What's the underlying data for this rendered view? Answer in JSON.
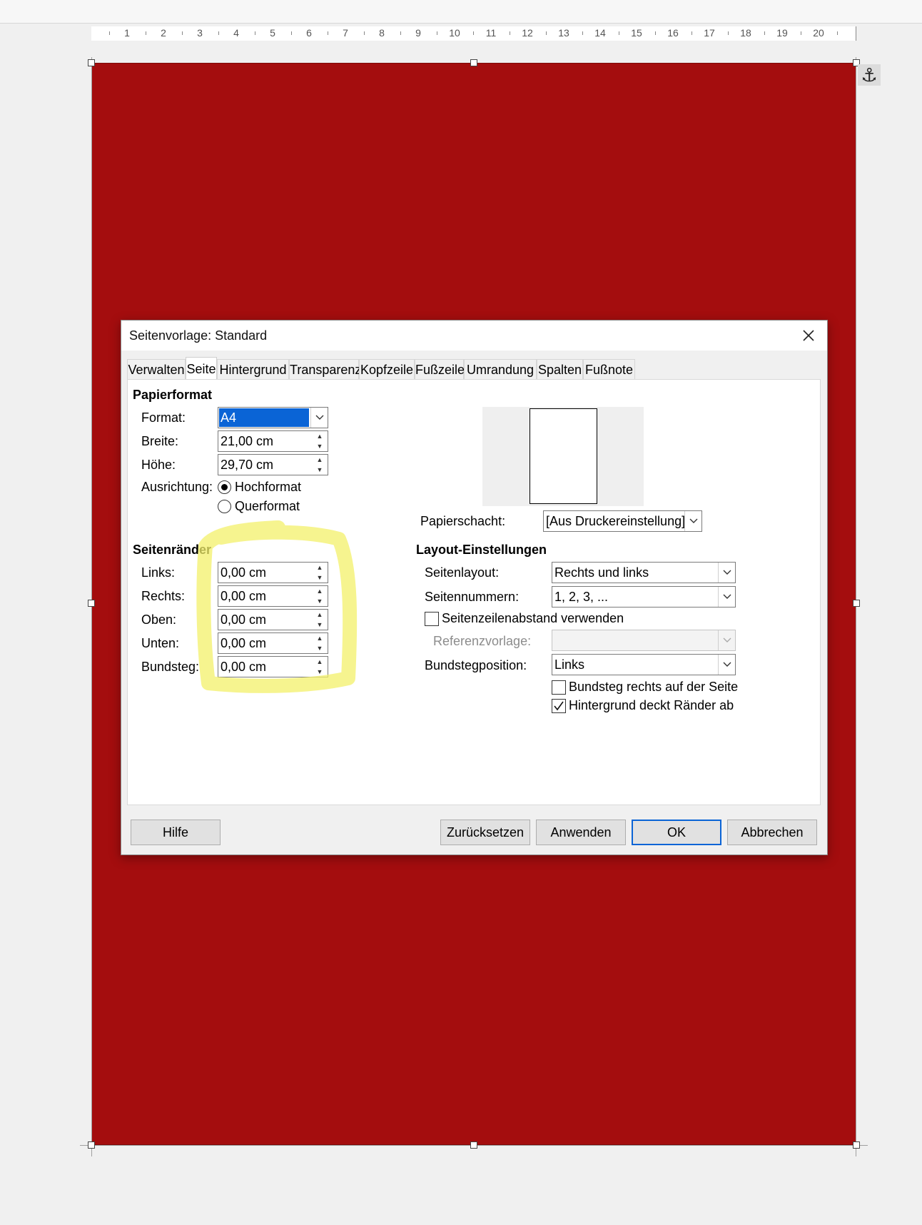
{
  "ruler": {
    "numbers": [
      "1",
      "2",
      "3",
      "4",
      "5",
      "6",
      "7",
      "8",
      "9",
      "10",
      "11",
      "12",
      "13",
      "14",
      "15",
      "16",
      "17",
      "18",
      "19",
      "20"
    ]
  },
  "page": {
    "background_color": "#a40d0e"
  },
  "dialog": {
    "title": "Seitenvorlage: Standard",
    "tabs": [
      "Verwalten",
      "Seite",
      "Hintergrund",
      "Transparenz",
      "Kopfzeile",
      "Fußzeile",
      "Umrandung",
      "Spalten",
      "Fußnote"
    ],
    "active_tab": "Seite",
    "papierformat": {
      "heading": "Papierformat",
      "format_label": "Format:",
      "format_value": "A4",
      "breite_label": "Breite:",
      "breite_value": "21,00 cm",
      "hoehe_label": "Höhe:",
      "hoehe_value": "29,70 cm",
      "ausrichtung_label": "Ausrichtung:",
      "hochformat": "Hochformat",
      "querformat": "Querformat",
      "selected_orientation": "Hochformat",
      "papierschacht_label": "Papierschacht:",
      "papierschacht_value": "[Aus Druckereinstellung]"
    },
    "seitenraender": {
      "heading": "Seitenränder",
      "links_label": "Links:",
      "links_value": "0,00 cm",
      "rechts_label": "Rechts:",
      "rechts_value": "0,00 cm",
      "oben_label": "Oben:",
      "oben_value": "0,00 cm",
      "unten_label": "Unten:",
      "unten_value": "0,00 cm",
      "bundsteg_label": "Bundsteg:",
      "bundsteg_value": "0,00 cm"
    },
    "layout": {
      "heading": "Layout-Einstellungen",
      "seitenlayout_label": "Seitenlayout:",
      "seitenlayout_value": "Rechts und links",
      "seitennummern_label": "Seitennummern:",
      "seitennummern_value": "1, 2, 3, ...",
      "seitenzeilenabstand_label": "Seitenzeilenabstand verwenden",
      "seitenzeilenabstand_checked": false,
      "referenzvorlage_label": "Referenzvorlage:",
      "referenzvorlage_value": "",
      "bundstegposition_label": "Bundstegposition:",
      "bundstegposition_value": "Links",
      "bundsteg_rechts_label": "Bundsteg rechts auf der Seite",
      "bundsteg_rechts_checked": false,
      "hintergrund_label": "Hintergrund deckt Ränder ab",
      "hintergrund_checked": true
    },
    "buttons": {
      "hilfe": "Hilfe",
      "zuruecksetzen": "Zurücksetzen",
      "anwenden": "Anwenden",
      "ok": "OK",
      "abbrechen": "Abbrechen"
    }
  },
  "annotation": {
    "highlight_color": "#f3f06a"
  }
}
